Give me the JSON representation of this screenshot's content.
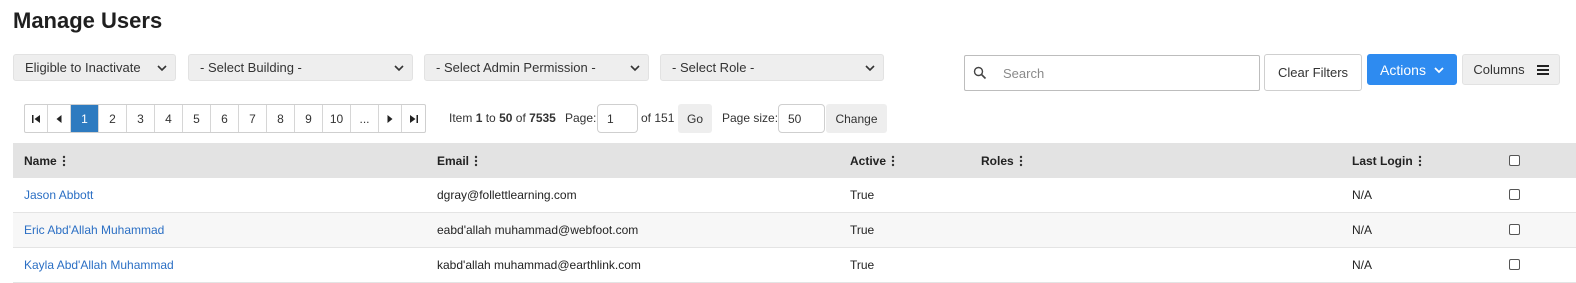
{
  "page": {
    "title": "Manage Users"
  },
  "filters": {
    "status": "Eligible to Inactivate",
    "building": "- Select Building -",
    "admin_permission": "- Select Admin Permission -",
    "role": "- Select Role -"
  },
  "search": {
    "placeholder": "Search",
    "value": ""
  },
  "toolbar": {
    "clear_filters": "Clear Filters",
    "actions": "Actions",
    "columns": "Columns"
  },
  "pager": {
    "pages": [
      "1",
      "2",
      "3",
      "4",
      "5",
      "6",
      "7",
      "8",
      "9",
      "10",
      "..."
    ],
    "active_page": "1",
    "item_label": "Item",
    "item_from": "1",
    "to_label": "to",
    "item_to": "50",
    "of_label": "of",
    "total_items": "7535",
    "page_label": "Page:",
    "current_page": "1",
    "of_pages": "of 151",
    "go": "Go",
    "page_size_label": "Page size:",
    "page_size": "50",
    "change": "Change"
  },
  "table": {
    "columns": {
      "name": "Name",
      "email": "Email",
      "active": "Active",
      "roles": "Roles",
      "last_login": "Last Login"
    },
    "rows": [
      {
        "name": "Jason Abbott",
        "email": "dgray@follettlearning.com",
        "active": "True",
        "roles": "",
        "last_login": "N/A"
      },
      {
        "name": "Eric Abd'Allah Muhammad",
        "email": "eabd'allah muhammad@webfoot.com",
        "active": "True",
        "roles": "",
        "last_login": "N/A"
      },
      {
        "name": "Kayla Abd'Allah Muhammad",
        "email": "kabd'allah muhammad@earthlink.com",
        "active": "True",
        "roles": "",
        "last_login": "N/A"
      }
    ]
  },
  "colors": {
    "accent": "#2e8bf0",
    "active_page": "#2e7bc0",
    "link": "#2b6fc4"
  },
  "icons": [
    "search-icon",
    "chevron-down-icon",
    "hamburger-icon",
    "first-page-icon",
    "prev-page-icon",
    "next-page-icon",
    "last-page-icon",
    "column-menu-icon"
  ]
}
